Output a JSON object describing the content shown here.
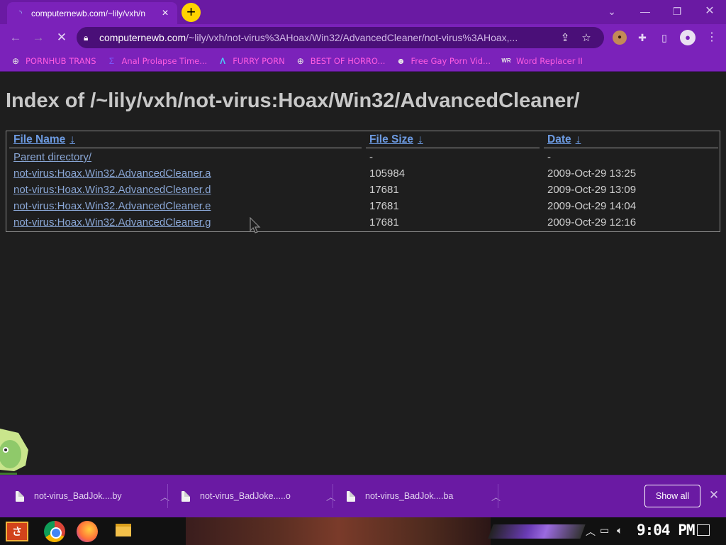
{
  "browser": {
    "tab": {
      "title": "computernewb.com/~lily/vxh/n"
    },
    "address": {
      "host": "computernewb.com",
      "path": "/~lily/vxh/not-virus%3AHoax/Win32/AdvancedCleaner/not-virus%3AHoax,..."
    },
    "bookmarks": [
      {
        "label": "PORNHUB TRANS",
        "icon": "globe-icon"
      },
      {
        "label": "Anal Prolapse Time...",
        "icon": "sigma-icon"
      },
      {
        "label": "FURRY PORN",
        "icon": "lambda-icon"
      },
      {
        "label": "BEST OF HORRO...",
        "icon": "globe-icon"
      },
      {
        "label": "Free Gay Porn Vid...",
        "icon": "mascot-icon"
      },
      {
        "label": "Word Replacer II",
        "icon": "wr-icon"
      }
    ]
  },
  "page": {
    "title": "Index of /~lily/vxh/not-virus:Hoax/Win32/AdvancedCleaner/",
    "columns": {
      "name": "File Name",
      "size": "File Size",
      "date": "Date",
      "sort_arrow": "↓"
    },
    "rows": [
      {
        "name": "Parent directory/",
        "size": "-",
        "date": "-"
      },
      {
        "name": "not-virus:Hoax.Win32.AdvancedCleaner.a",
        "size": "105984",
        "date": "2009-Oct-29 13:25"
      },
      {
        "name": "not-virus:Hoax.Win32.AdvancedCleaner.d",
        "size": "17681",
        "date": "2009-Oct-29 13:09"
      },
      {
        "name": "not-virus:Hoax.Win32.AdvancedCleaner.e",
        "size": "17681",
        "date": "2009-Oct-29 14:04"
      },
      {
        "name": "not-virus:Hoax.Win32.AdvancedCleaner.g",
        "size": "17681",
        "date": "2009-Oct-29 12:16"
      }
    ]
  },
  "downloads": {
    "items": [
      {
        "name": "not-virus_BadJok....by"
      },
      {
        "name": "not-virus_BadJoke.....o"
      },
      {
        "name": "not-virus_BadJok....ba"
      }
    ],
    "show_all": "Show all"
  },
  "taskbar": {
    "clock": "9:04 PM"
  },
  "colors": {
    "chrome_purple": "#7b22ba",
    "bookmark_pink": "#ff5ce1",
    "link_blue": "#6d9be2",
    "new_tab_yellow": "#ffd400"
  }
}
